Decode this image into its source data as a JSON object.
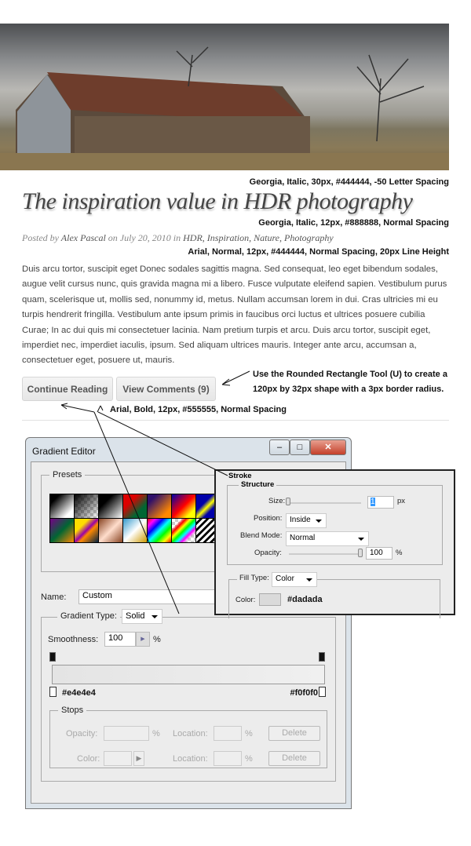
{
  "annotations": {
    "title_spec": "Georgia, Italic, 30px, #444444, -50 Letter Spacing",
    "meta_spec": "Georgia, Italic, 12px, #888888, Normal Spacing",
    "body_spec": "Arial, Normal, 12px, #444444, Normal Spacing, 20px Line Height",
    "button_note_1": "Use the Rounded Rectangle Tool (U) to create a",
    "button_note_2": "120px by 32px shape with a 3px border radius.",
    "button_font_spec": "Arial, Bold, 12px, #555555, Normal Spacing"
  },
  "post": {
    "title": "The inspiration value in HDR photography",
    "posted_by": "Posted by",
    "author": "Alex Pascal",
    "on": "on July 20, 2010 in",
    "categories": "HDR, Inspiration, Nature, Photography",
    "body": "Duis arcu tortor, suscipit eget Donec sodales sagittis magna. Sed consequat, leo eget bibendum sodales, augue velit cursus nunc, quis gravida magna mi a libero. Fusce vulputate eleifend sapien. Vestibulum purus quam, scelerisque ut, mollis sed, nonummy id, metus. Nullam accumsan lorem in dui. Cras ultricies mi eu turpis hendrerit fringilla. Vestibulum ante ipsum primis in faucibus orci luctus et ultrices posuere cubilia Curae; In ac dui quis mi consectetuer lacinia. Nam pretium turpis et arcu. Duis arcu tortor, suscipit eget, imperdiet nec, imperdiet iaculis, ipsum. Sed aliquam ultrices mauris. Integer ante arcu, accumsan a, consectetuer eget, posuere ut, mauris.",
    "continue_label": "Continue Reading",
    "comments_label": "View Comments (9)"
  },
  "gradient_editor": {
    "title": "Gradient Editor",
    "presets_label": "Presets",
    "name_label": "Name:",
    "name_value": "Custom",
    "gradient_type_label": "Gradient Type:",
    "gradient_type_value": "Solid",
    "smoothness_label": "Smoothness:",
    "smoothness_value": "100",
    "percent": "%",
    "left_color": "#e4e4e4",
    "right_color": "#f0f0f0",
    "stops_label": "Stops",
    "opacity_label": "Opacity:",
    "color_label": "Color:",
    "location_label": "Location:",
    "delete_label": "Delete"
  },
  "stroke": {
    "title": "Stroke",
    "structure": "Structure",
    "size_label": "Size:",
    "size_value": "1",
    "size_unit": "px",
    "position_label": "Position:",
    "position_value": "Inside",
    "blend_label": "Blend Mode:",
    "blend_value": "Normal",
    "opacity_label": "Opacity:",
    "opacity_value": "100",
    "opacity_unit": "%",
    "fill_type_label": "Fill Type:",
    "fill_type_value": "Color",
    "color_label": "Color:",
    "color_value": "#dadada"
  }
}
